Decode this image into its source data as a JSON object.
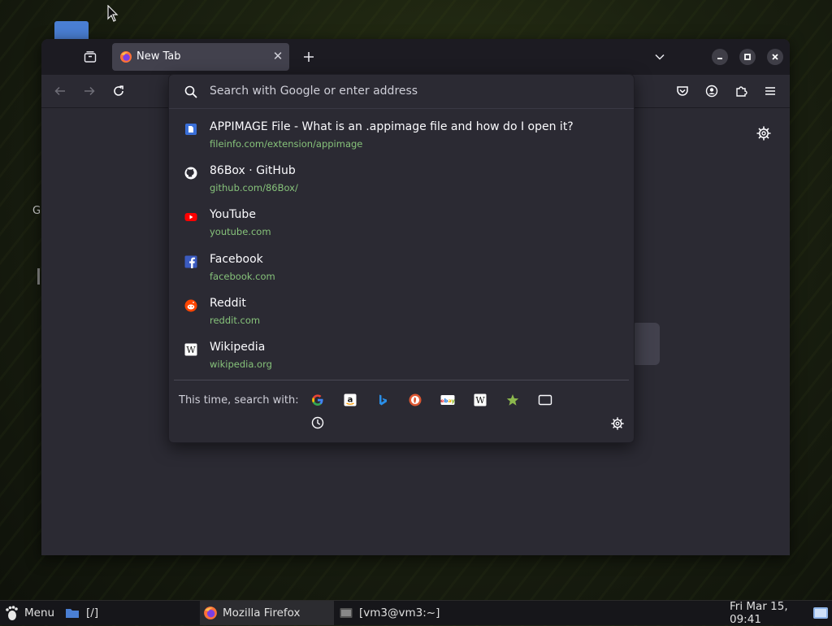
{
  "browser": {
    "tab_title": "New Tab",
    "address_placeholder": "Search with Google or enter address"
  },
  "suggestions": [
    {
      "icon": "document-icon",
      "title": "APPIMAGE File - What is an .appimage file and how do I open it?",
      "url": "fileinfo.com/extension/appimage"
    },
    {
      "icon": "github-icon",
      "title": "86Box · GitHub",
      "url": "github.com/86Box/"
    },
    {
      "icon": "youtube-icon",
      "title": "YouTube",
      "url": "youtube.com"
    },
    {
      "icon": "facebook-icon",
      "title": "Facebook",
      "url": "facebook.com"
    },
    {
      "icon": "reddit-icon",
      "title": "Reddit",
      "url": "reddit.com"
    },
    {
      "icon": "wikipedia-icon",
      "title": "Wikipedia",
      "url": "wikipedia.org"
    }
  ],
  "search_engines": {
    "label": "This time, search with:",
    "engines": [
      "google-icon",
      "amazon-icon",
      "bing-icon",
      "duckduckgo-icon",
      "ebay-icon",
      "wikipedia-icon",
      "bookmarks-icon",
      "tabs-icon",
      "history-icon"
    ]
  },
  "desktop": {
    "partial_label": "G"
  },
  "taskbar": {
    "menu_label": "Menu",
    "files_label": "[/]",
    "firefox_label": "Mozilla Firefox",
    "terminal_label": "[vm3@vm3:~]",
    "clock": "Fri Mar 15, 09:41"
  },
  "colors": {
    "url_green": "#86c27a",
    "popup_bg": "#2b2a33",
    "tab_active": "#42414d"
  }
}
